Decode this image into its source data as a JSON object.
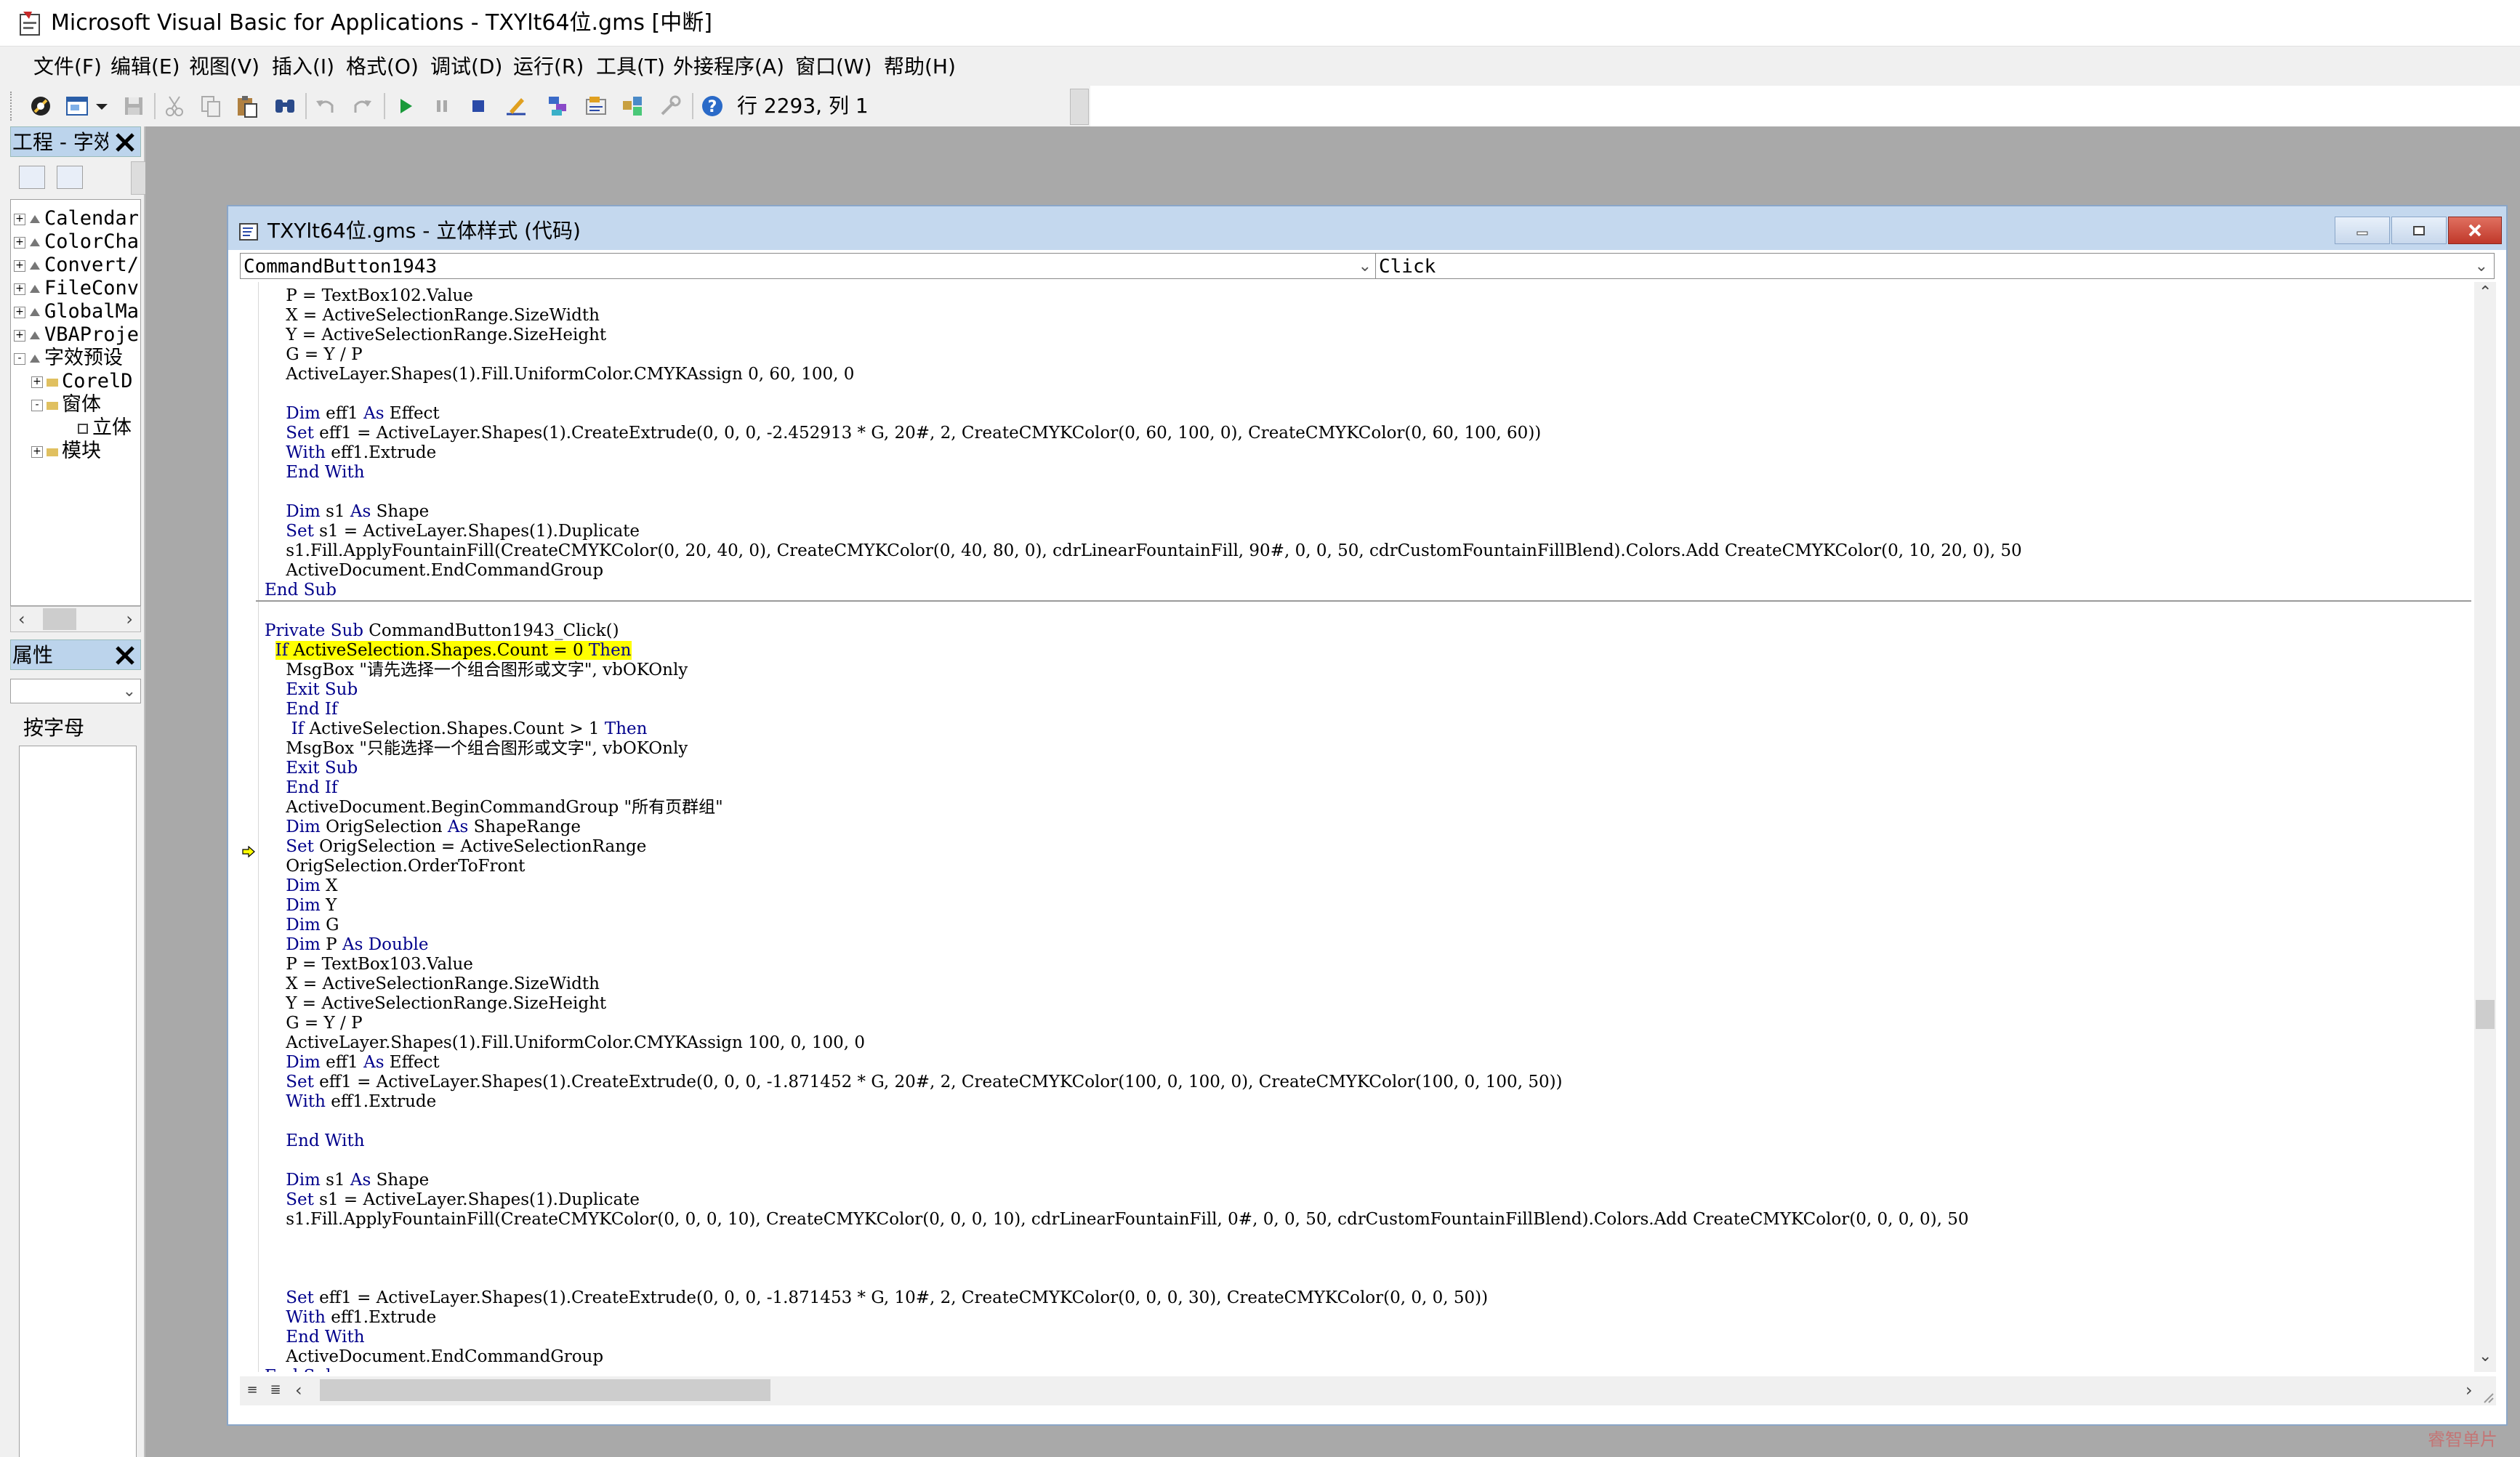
{
  "window": {
    "title": "Microsoft Visual Basic for Applications - TXYlt64位.gms [中断]"
  },
  "menu": [
    "文件(F)",
    "编辑(E)",
    "视图(V)",
    "插入(I)",
    "格式(O)",
    "调试(D)",
    "运行(R)",
    "工具(T)",
    "外接程序(A)",
    "窗口(W)",
    "帮助(H)"
  ],
  "toolbar": {
    "cursor_position": "行 2293, 列 1",
    "icons": [
      "view-excel-icon",
      "insert-userform-icon",
      "dropdown-arrow-icon",
      "save-icon",
      "cut-icon",
      "copy-icon",
      "paste-icon",
      "find-icon",
      "undo-icon",
      "redo-icon",
      "run-icon",
      "break-icon",
      "reset-icon",
      "design-mode-icon",
      "project-explorer-icon",
      "properties-icon",
      "object-browser-icon",
      "toolbox-icon",
      "help-icon"
    ]
  },
  "project_pane": {
    "title": "工程 - 字效",
    "tree": [
      {
        "label": "Calendar",
        "indent": 0,
        "expander": "+"
      },
      {
        "label": "ColorCha",
        "indent": 0,
        "expander": "+"
      },
      {
        "label": "Convert/",
        "indent": 0,
        "expander": "+"
      },
      {
        "label": "FileConv",
        "indent": 0,
        "expander": "+"
      },
      {
        "label": "GlobalMa",
        "indent": 0,
        "expander": "+"
      },
      {
        "label": "VBAProje",
        "indent": 0,
        "expander": "+"
      },
      {
        "label": "字效预设",
        "indent": 0,
        "expander": "-"
      },
      {
        "label": "CorelD",
        "indent": 1,
        "expander": "+"
      },
      {
        "label": "窗体",
        "indent": 1,
        "expander": "-"
      },
      {
        "label": "立体",
        "indent": 2,
        "expander": ""
      },
      {
        "label": "模块",
        "indent": 1,
        "expander": "+"
      }
    ]
  },
  "properties_pane": {
    "title": "属性",
    "tab_label": "按字母"
  },
  "code_window": {
    "title": "TXYlt64位.gms - 立体样式 (代码)",
    "object_combo": "CommandButton1943",
    "procedure_combo": "Click"
  },
  "watermark": "睿智单片"
}
